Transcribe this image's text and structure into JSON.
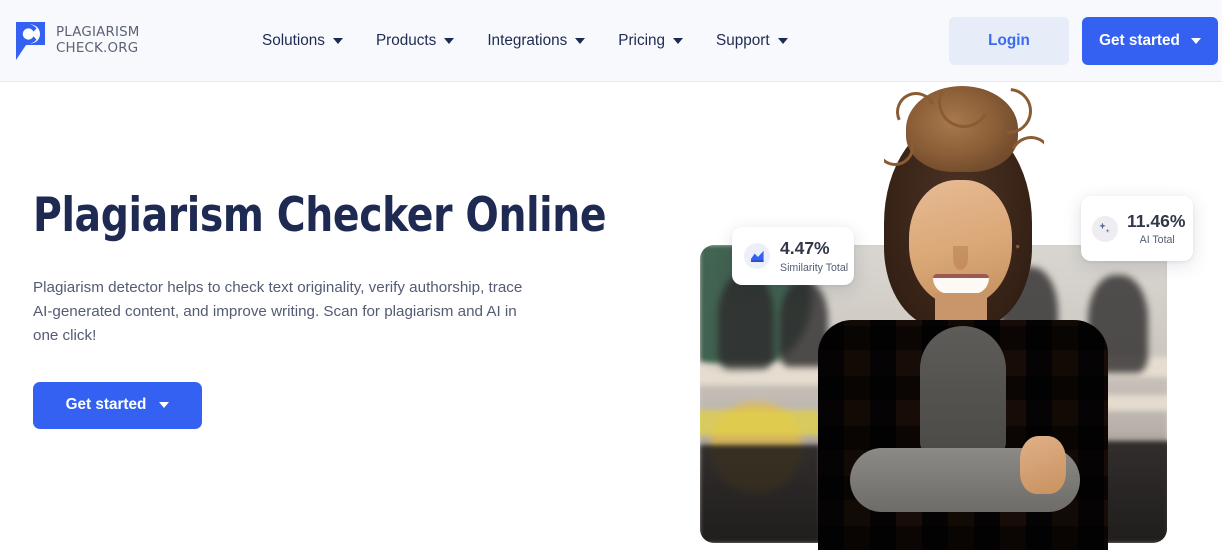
{
  "brand": {
    "name_line1": "PLAGIARISM",
    "name_line2": "CHECK.ORG",
    "logo_letter": "C",
    "accent_color": "#3461f2",
    "logo_color": "#3461f2",
    "heading_color": "#1e2a52"
  },
  "header": {
    "background_color": "#f7f9fc",
    "nav": [
      {
        "label": "Solutions",
        "has_dropdown": true
      },
      {
        "label": "Products",
        "has_dropdown": true
      },
      {
        "label": "Integrations",
        "has_dropdown": true
      },
      {
        "label": "Pricing",
        "has_dropdown": true
      },
      {
        "label": "Support",
        "has_dropdown": true
      }
    ],
    "login_label": "Login",
    "get_started_label": "Get started"
  },
  "hero": {
    "title": "Plagiarism Checker Online",
    "subtitle": "Plagiarism detector helps to check text originality, verify authorship, trace AI-generated content, and improve writing. Scan for plagiarism and AI in one click!",
    "cta_label": "Get started"
  },
  "stat_cards": [
    {
      "icon": "chart-icon",
      "value": "4.47%",
      "label": "Similarity Total"
    },
    {
      "icon": "sparkle-icon",
      "value": "11.46%",
      "label": "AI Total"
    }
  ],
  "hero_image": {
    "alt": "Smiling woman with curly hair in plaid shirt standing with arms crossed in a classroom"
  }
}
